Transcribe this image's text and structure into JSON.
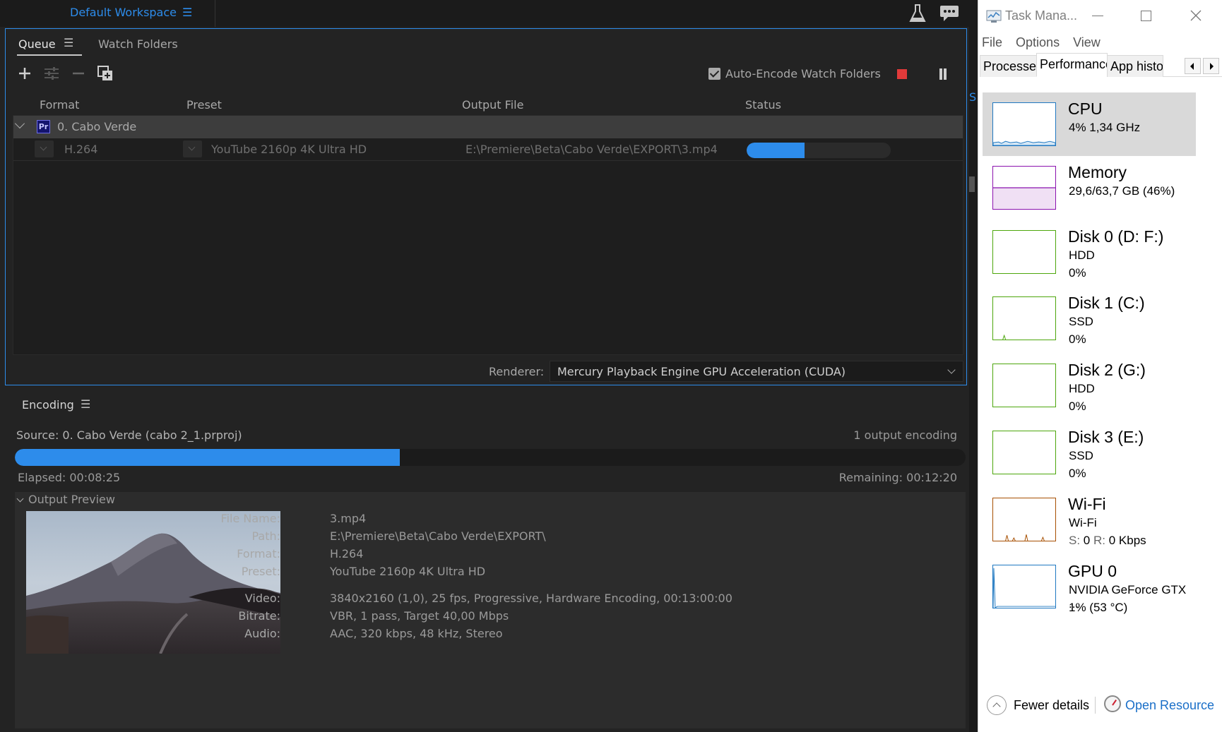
{
  "media_encoder": {
    "workspace": {
      "title": "Default Workspace",
      "menu_icon": "hamburger-menu-icon"
    },
    "top_icons": [
      "flask-icon",
      "chat-bubble-icon"
    ],
    "queue_panel": {
      "tabs": [
        {
          "label": "Queue",
          "active": true
        },
        {
          "label": "Watch Folders",
          "active": false
        }
      ],
      "toolbar": {
        "icons": [
          "add-icon",
          "settings-sliders-icon",
          "remove-icon",
          "duplicate-icon"
        ],
        "auto_encode": {
          "label": "Auto-Encode Watch Folders",
          "checked": true
        },
        "stop_color": "#e13a3a"
      },
      "columns": [
        "Format",
        "Preset",
        "Output File",
        "Status"
      ],
      "group": {
        "badge": "Pr",
        "name": "0. Cabo Verde"
      },
      "item": {
        "format": "H.264",
        "preset": "YouTube 2160p 4K Ultra HD",
        "output_file": "E:\\Premiere\\Beta\\Cabo Verde\\EXPORT\\3.mp4",
        "progress": 0.4
      },
      "renderer": {
        "label": "Renderer:",
        "value": "Mercury Playback Engine GPU Acceleration (CUDA)"
      }
    },
    "encoding_panel": {
      "tab": "Encoding",
      "source": "Source: 0. Cabo Verde (cabo 2_1.prproj)",
      "outputs": "1 output encoding",
      "progress": 0.405,
      "elapsed": "Elapsed: 00:08:25",
      "remaining": "Remaining: 00:12:20",
      "preview_header": "Output Preview",
      "meta": {
        "file_name_key": "File Name:",
        "file_name": "3.mp4",
        "path_key": "Path:",
        "path": "E:\\Premiere\\Beta\\Cabo Verde\\EXPORT\\",
        "format_key": "Format:",
        "format": "H.264",
        "preset_key": "Preset:",
        "preset": "YouTube 2160p 4K Ultra HD",
        "video_key": "Video:",
        "video": "3840x2160 (1,0), 25 fps, Progressive, Hardware Encoding, 00:13:00:00",
        "bitrate_key": "Bitrate:",
        "bitrate": "VBR, 1 pass, Target 40,00 Mbps",
        "audio_key": "Audio:",
        "audio": "AAC, 320 kbps, 48 kHz, Stereo"
      }
    },
    "accent_color": "#2d8ceb",
    "side_strip_text": "S"
  },
  "task_manager": {
    "title": "Task Mana...",
    "menu": [
      "File",
      "Options",
      "View"
    ],
    "tabs": [
      {
        "label": "Processes",
        "active": false
      },
      {
        "label": "Performance",
        "active": true
      },
      {
        "label": "App histor",
        "active": false
      }
    ],
    "items": [
      {
        "name": "CPU",
        "sub1": "4% 1,34 GHz",
        "sub2": "",
        "color": "#1f78c1",
        "selected": true
      },
      {
        "name": "Memory",
        "sub1": "29,6/63,7 GB (46%)",
        "sub2": "",
        "color": "#8b12ae",
        "selected": false
      },
      {
        "name": "Disk 0 (D: F:)",
        "sub1": "HDD",
        "sub2": "0%",
        "color": "#4da60c",
        "selected": false
      },
      {
        "name": "Disk 1 (C:)",
        "sub1": "SSD",
        "sub2": "0%",
        "color": "#4da60c",
        "selected": false
      },
      {
        "name": "Disk 2 (G:)",
        "sub1": "HDD",
        "sub2": "0%",
        "color": "#4da60c",
        "selected": false
      },
      {
        "name": "Disk 3 (E:)",
        "sub1": "SSD",
        "sub2": "0%",
        "color": "#4da60c",
        "selected": false
      },
      {
        "name": "Wi-Fi",
        "sub1": "Wi-Fi",
        "sub2_s_label": "S:",
        "sub2_s": "0",
        "sub2_r_label": "R:",
        "sub2_r": "0 Kbps",
        "color": "#a74f01",
        "selected": false
      },
      {
        "name": "GPU 0",
        "sub1": "NVIDIA GeForce GTX ...",
        "sub2": "1% (53 °C)",
        "color": "#1f78c1",
        "selected": false
      }
    ],
    "footer": {
      "fewer_details": "Fewer details",
      "open_resource": "Open Resource"
    }
  }
}
